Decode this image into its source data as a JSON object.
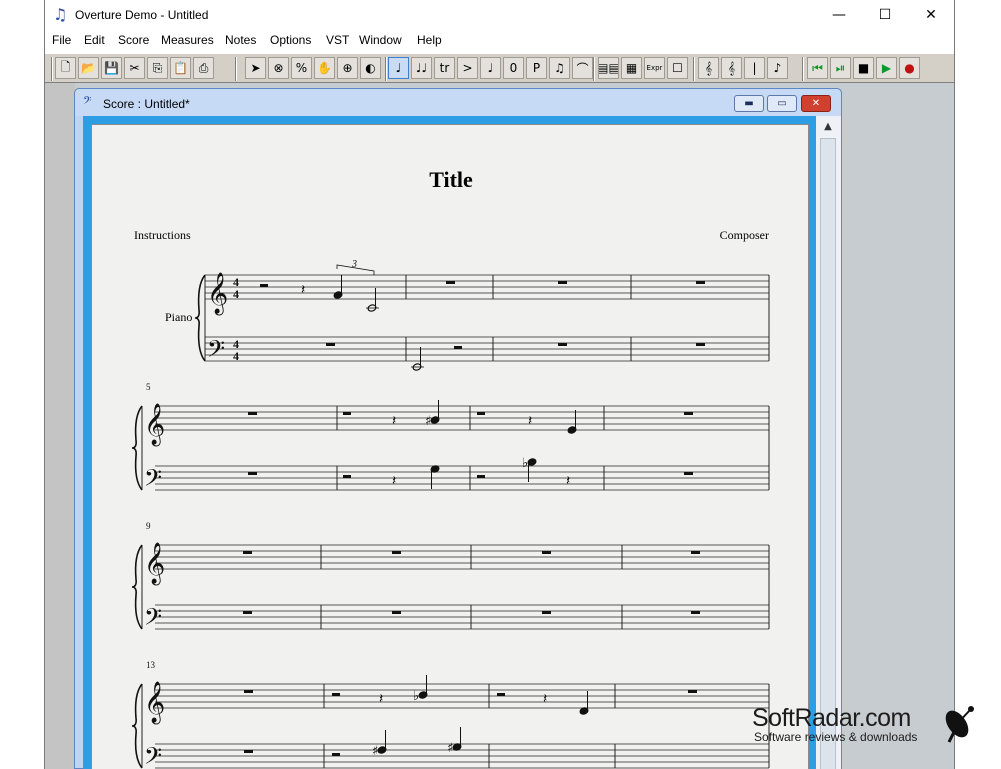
{
  "window": {
    "title": "Overture Demo - Untitled",
    "icon": "music-note-icon",
    "minimize": "—",
    "maximize": "☐",
    "close": "✕"
  },
  "menu": [
    "File",
    "Edit",
    "Score",
    "Measures",
    "Notes",
    "Options",
    "VST",
    "Window",
    "Help"
  ],
  "toolbar": {
    "file_tools": [
      {
        "name": "new-document-icon",
        "glyph": "🗋"
      },
      {
        "name": "open-folder-icon",
        "glyph": "📂"
      },
      {
        "name": "save-icon",
        "glyph": "💾"
      },
      {
        "name": "cut-icon",
        "glyph": "✂"
      },
      {
        "name": "copy-icon",
        "glyph": "⎘"
      },
      {
        "name": "paste-icon",
        "glyph": "📋"
      },
      {
        "name": "print-icon",
        "glyph": "⎙"
      }
    ],
    "edit_tools": [
      {
        "name": "pointer-icon",
        "glyph": "➤"
      },
      {
        "name": "erase-icon",
        "glyph": "⊗"
      },
      {
        "name": "percent-icon",
        "glyph": "%"
      },
      {
        "name": "hand-icon",
        "glyph": "✋"
      },
      {
        "name": "zoom-icon",
        "glyph": "⊕"
      },
      {
        "name": "speaker-icon",
        "glyph": "◐"
      }
    ],
    "note_tools": [
      {
        "name": "note-icon",
        "glyph": "♩"
      },
      {
        "name": "tied-notes-icon",
        "glyph": "♩♩"
      },
      {
        "name": "trill-icon",
        "glyph": "tr"
      },
      {
        "name": "accent-icon",
        "glyph": ">"
      },
      {
        "name": "quarter-note-icon",
        "glyph": "♩"
      },
      {
        "name": "fingering-icon",
        "glyph": "0"
      },
      {
        "name": "dynamic-icon",
        "glyph": "P"
      },
      {
        "name": "beamed-notes-icon",
        "glyph": "♫"
      },
      {
        "name": "slur-icon",
        "glyph": "⌒"
      }
    ],
    "layout_tools": [
      {
        "name": "tablature-icon",
        "glyph": "▤▤"
      },
      {
        "name": "chord-grid-icon",
        "glyph": "▦"
      },
      {
        "name": "expression-icon",
        "glyph": "Expr"
      },
      {
        "name": "box-icon",
        "glyph": "☐"
      }
    ],
    "clef_tools": [
      {
        "name": "treble-clef-icon",
        "glyph": "𝄞"
      },
      {
        "name": "grand-staff-icon",
        "glyph": "𝄞"
      },
      {
        "name": "barline-icon",
        "glyph": "|"
      },
      {
        "name": "note-speaker-icon",
        "glyph": "♪"
      }
    ],
    "transport_tools": [
      {
        "name": "rewind-icon",
        "glyph": "⏮"
      },
      {
        "name": "play-from-icon",
        "glyph": "⏯"
      },
      {
        "name": "stop-icon",
        "glyph": "■"
      },
      {
        "name": "play-icon",
        "glyph": "▶"
      },
      {
        "name": "record-icon",
        "glyph": "●"
      }
    ]
  },
  "score_window": {
    "title": "Score : Untitled*",
    "icon": "score-icon"
  },
  "score": {
    "title": "Title",
    "instructions": "Instructions",
    "composer": "Composer",
    "instrument": "Piano",
    "time_signature": {
      "top": "4",
      "bottom": "4"
    },
    "tuplet": "3",
    "system_numbers": [
      "5",
      "9",
      "13"
    ]
  },
  "watermark": {
    "brand": "SoftRadar.com",
    "tagline": "Software reviews & downloads"
  }
}
